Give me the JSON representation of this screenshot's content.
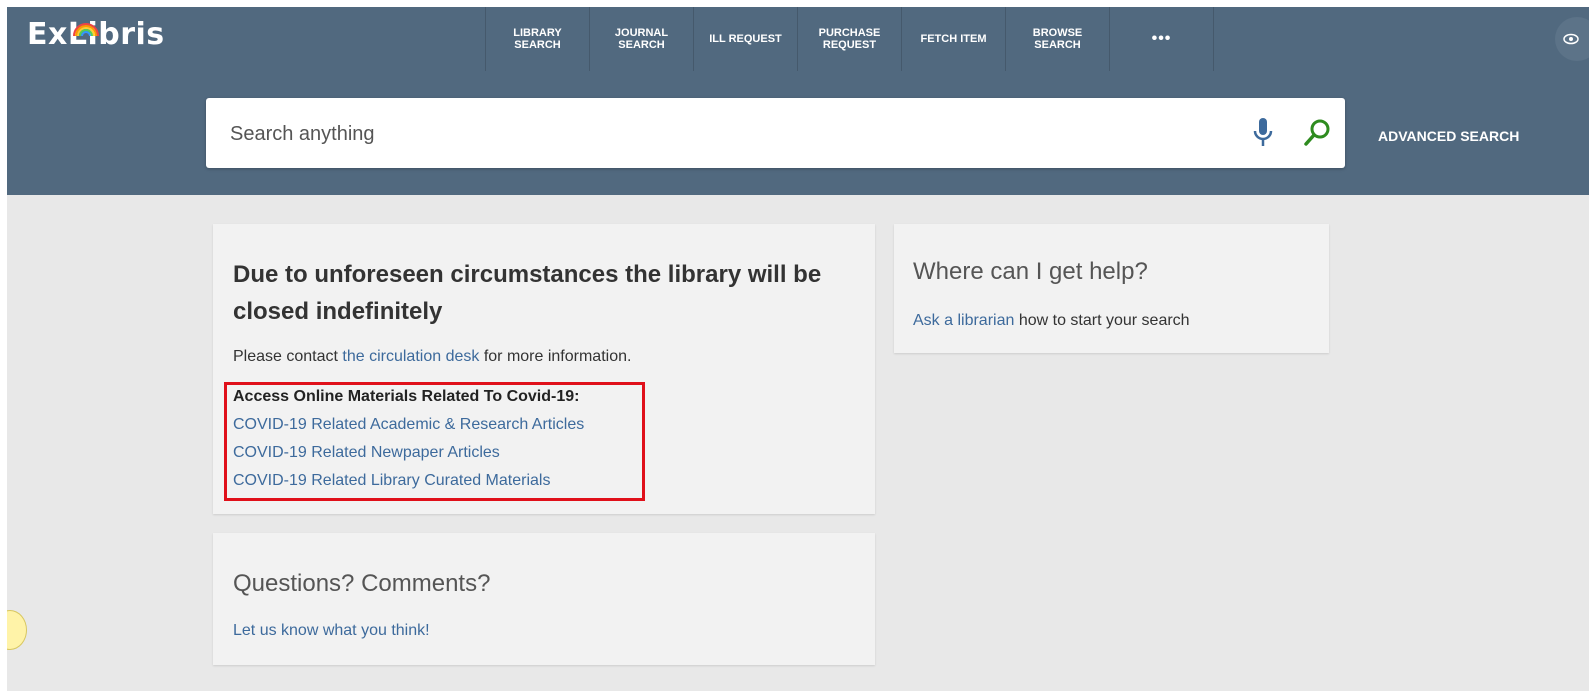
{
  "header": {
    "logo_text": "ExLibris",
    "nav": [
      {
        "label": "LIBRARY\nSEARCH"
      },
      {
        "label": "JOURNAL\nSEARCH"
      },
      {
        "label": "ILL REQUEST"
      },
      {
        "label": "PURCHASE\nREQUEST"
      },
      {
        "label": "FETCH ITEM"
      },
      {
        "label": "BROWSE\nSEARCH"
      },
      {
        "label": "•••"
      }
    ]
  },
  "search": {
    "placeholder": "Search anything",
    "value": "",
    "advanced_label": "ADVANCED SEARCH"
  },
  "notice": {
    "title": "Due to unforeseen circumstances the library will be closed indefinitely",
    "contact_prefix": "Please contact ",
    "contact_link": "the circulation desk",
    "contact_suffix": " for more information.",
    "covid_heading": "Access Online Materials Related To Covid-19:",
    "covid_links": [
      "COVID-19 Related Academic & Research Articles",
      "COVID-19 Related Newpaper Articles",
      "COVID-19 Related Library Curated Materials"
    ]
  },
  "help": {
    "title": "Where can I get help?",
    "link": "Ask a librarian",
    "suffix": " how to start your search"
  },
  "feedback": {
    "title": "Questions? Comments?",
    "link": "Let us know what you think!"
  },
  "colors": {
    "header_bg": "#51697f",
    "page_bg": "#e8e8e8",
    "card_bg": "#f2f2f2",
    "link": "#3d6a9c",
    "highlight_border": "#e0101a",
    "search_icon": "#2e8b1f",
    "mic_icon": "#3d6a9c"
  },
  "icons": {
    "mic": "microphone-icon",
    "search": "magnifier-icon",
    "eye": "eye-icon",
    "more": "more-dots-icon"
  }
}
